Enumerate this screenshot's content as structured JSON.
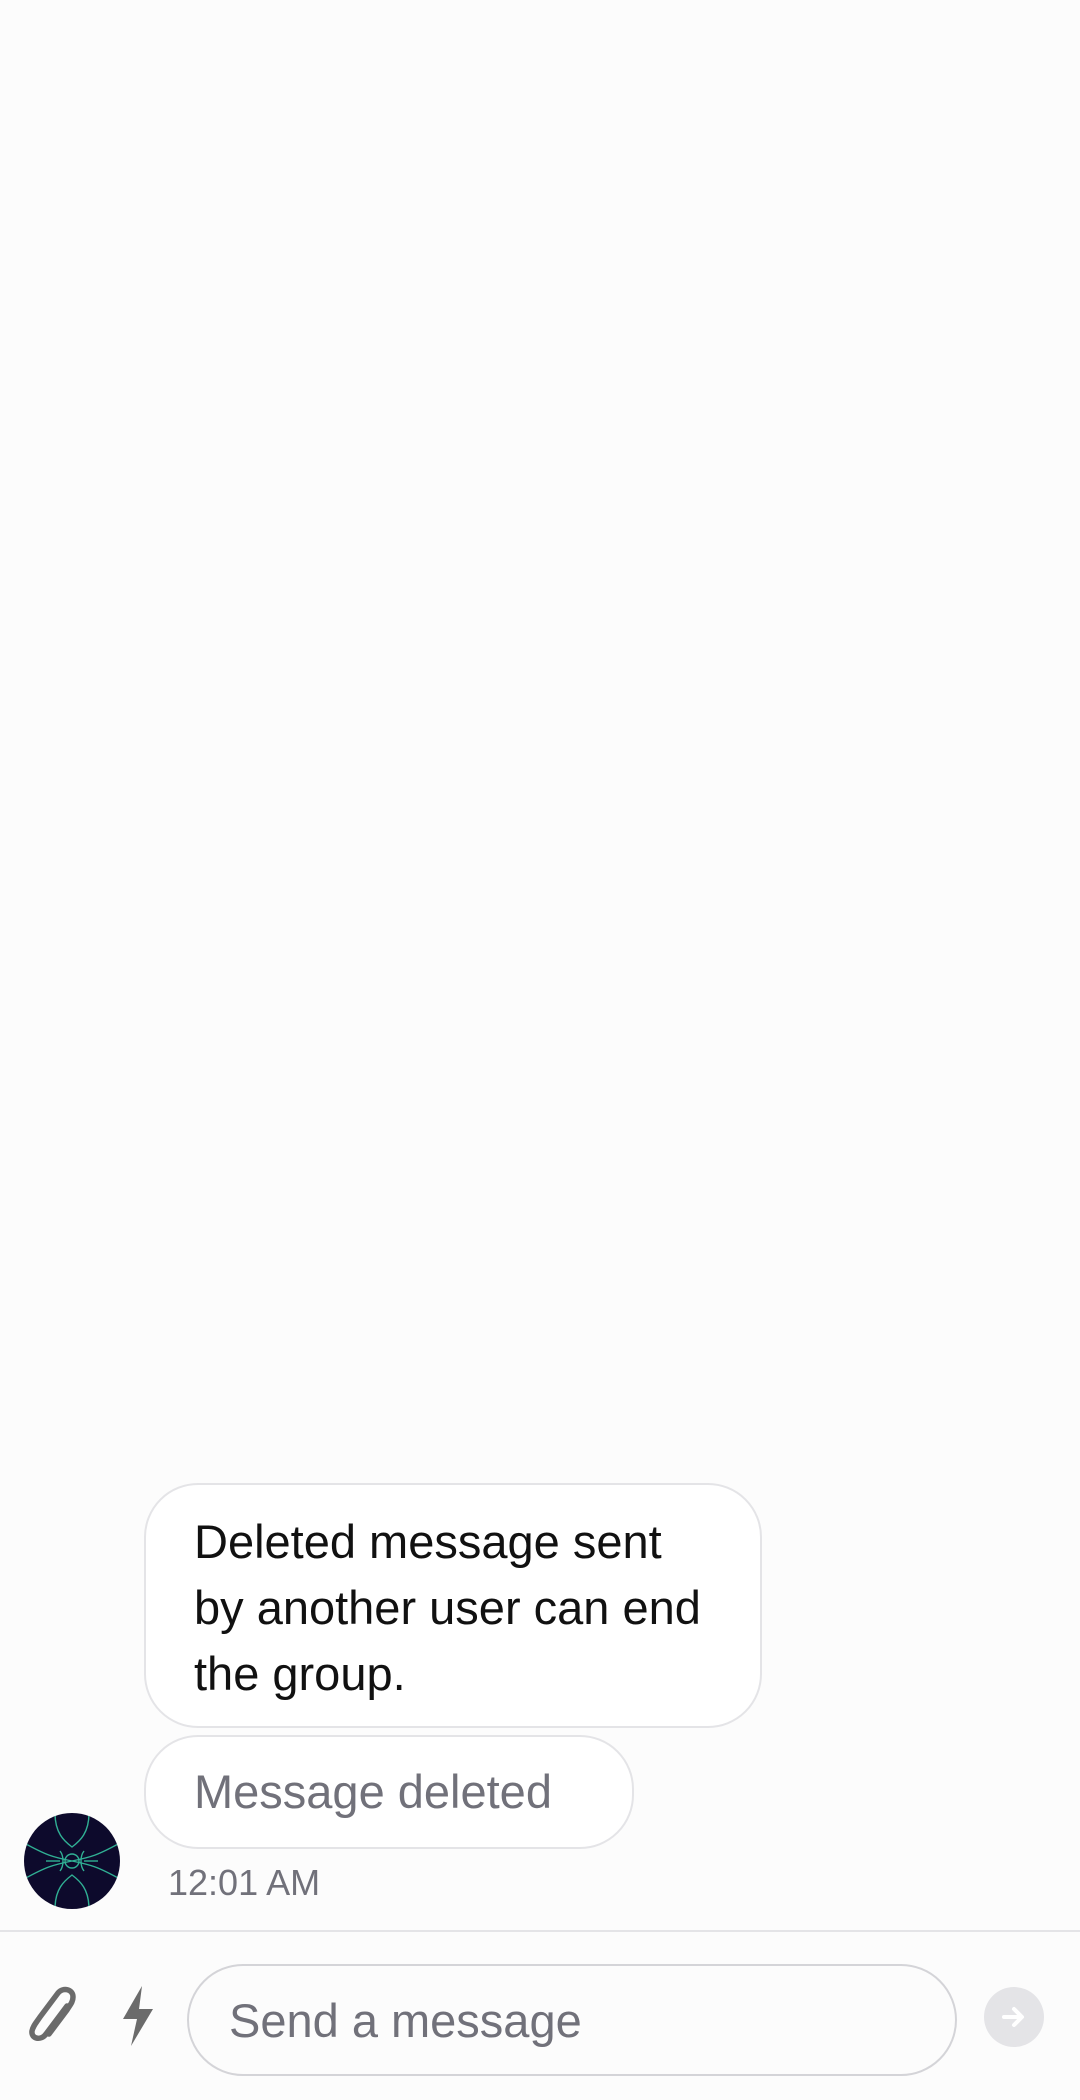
{
  "messages": [
    {
      "text": "Deleted message sent by another user can end the group."
    },
    {
      "text": "Message deleted"
    }
  ],
  "message_group": {
    "timestamp": "12:01 AM",
    "avatar_icon": "abstract-pattern-avatar"
  },
  "composer": {
    "placeholder": "Send a message",
    "attach_icon": "paperclip-icon",
    "commands_icon": "lightning-bolt-icon",
    "send_icon": "arrow-right-icon"
  },
  "colors": {
    "background": "#fcfcfc",
    "bubble_background": "#ffffff",
    "bubble_border": "#e4e4e7",
    "muted_text": "#71717a",
    "avatar_background": "#0d0a2c",
    "avatar_accent": "#35c3a0"
  }
}
